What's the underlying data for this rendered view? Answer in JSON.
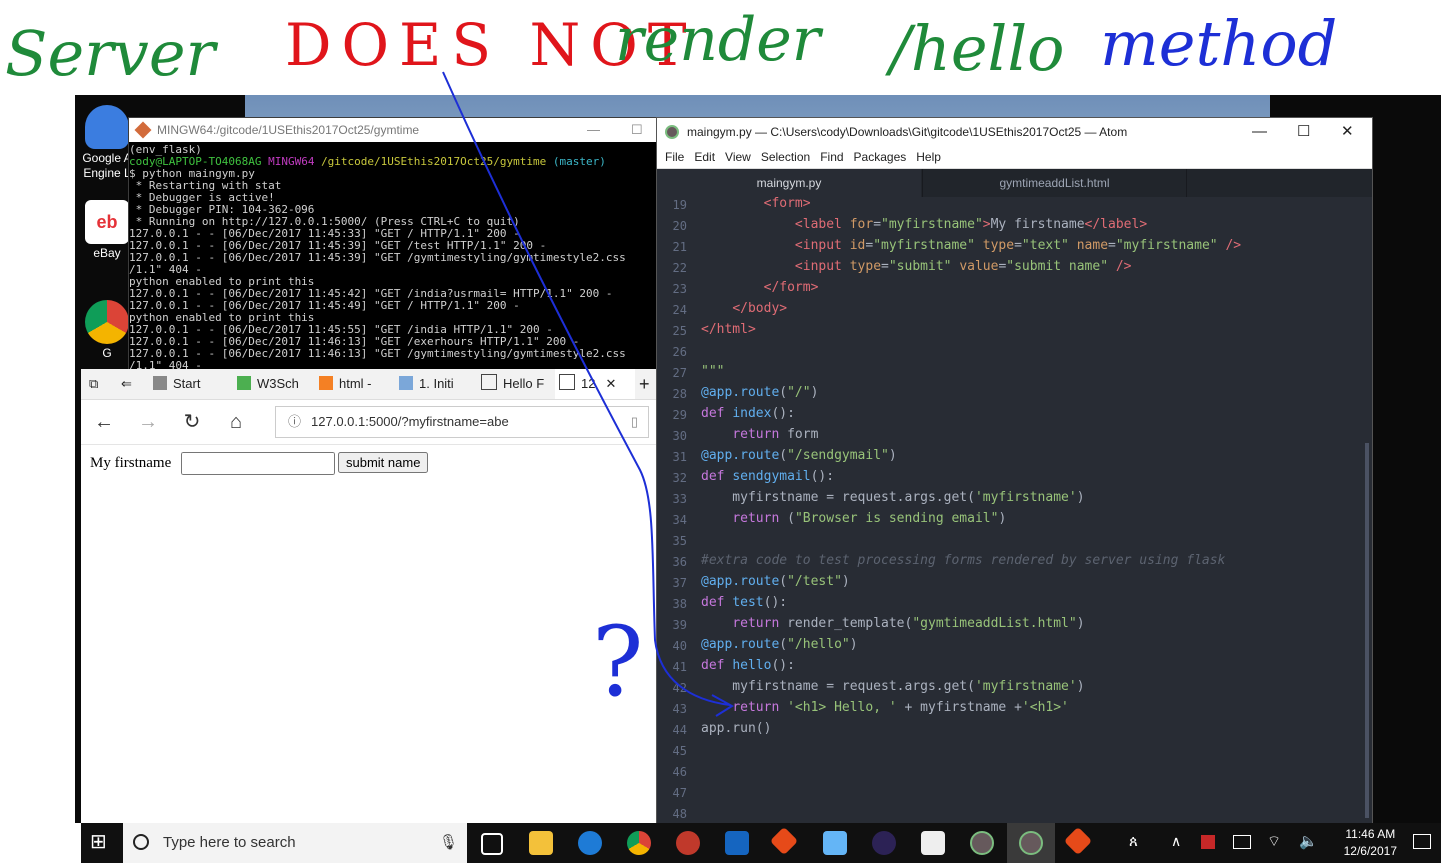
{
  "annotation": {
    "word1": "Server",
    "word2": "DOES NOT",
    "word3": "render",
    "word4": "/hello",
    "word5": "method",
    "question": "?"
  },
  "desktop_icons": [
    {
      "label": "Google A Engine L"
    },
    {
      "label": "eBay"
    },
    {
      "label": "G"
    }
  ],
  "terminal": {
    "title": "MINGW64:/gitcode/1USEthis2017Oct25/gymtime",
    "lines": {
      "l1": "(env_flask)",
      "l2_user": "cody@LAPTOP-TO4068AG",
      "l2_mingw": "MINGW64",
      "l2_path": "/gitcode/1USEthis2017Oct25/gymtime",
      "l2_branch": "(master)",
      "l3": "$ python maingym.py",
      "l4": " * Restarting with stat",
      "l5": " * Debugger is active!",
      "l6": " * Debugger PIN: 104-362-096",
      "l7": " * Running on http://127.0.0.1:5000/ (Press CTRL+C to quit)",
      "l8": "127.0.0.1 - - [06/Dec/2017 11:45:33] \"GET / HTTP/1.1\" 200 -",
      "l9": "127.0.0.1 - - [06/Dec/2017 11:45:39] \"GET /test HTTP/1.1\" 200 -",
      "l10": "127.0.0.1 - - [06/Dec/2017 11:45:39] \"GET /gymtimestyling/gymtimestyle2.css",
      "l11": "/1.1\" 404 -",
      "l12": "python enabled to print this",
      "l13": "127.0.0.1 - - [06/Dec/2017 11:45:42] \"GET /india?usrmail= HTTP/1.1\" 200 -",
      "l14": "127.0.0.1 - - [06/Dec/2017 11:45:49] \"GET / HTTP/1.1\" 200 -",
      "l15": "python enabled to print this",
      "l16": "127.0.0.1 - - [06/Dec/2017 11:45:55] \"GET /india HTTP/1.1\" 200 -",
      "l17": "127.0.0.1 - - [06/Dec/2017 11:46:13] \"GET /exerhours HTTP/1.1\" 200 -",
      "l18": "127.0.0.1 - - [06/Dec/2017 11:46:13] \"GET /gymtimestyling/gymtimestyle2.css",
      "l19": "/1.1\" 404 -"
    }
  },
  "browser": {
    "tabs": [
      "Start",
      "W3Sch",
      "html -",
      "1. Initi",
      "Hello F",
      "12"
    ],
    "url": "127.0.0.1:5000/?myfirstname=abe",
    "form_label": "My firstname",
    "submit_label": "submit name"
  },
  "atom": {
    "title": "maingym.py — C:\\Users\\cody\\Downloads\\Git\\gitcode\\1USEthis2017Oct25 — Atom",
    "menu": [
      "File",
      "Edit",
      "View",
      "Selection",
      "Find",
      "Packages",
      "Help"
    ],
    "tabs": [
      "maingym.py",
      "gymtimeaddList.html"
    ],
    "line_numbers": [
      "19",
      "20",
      "21",
      "22",
      "23",
      "24",
      "25",
      "26",
      "27",
      "28",
      "29",
      "30",
      "31",
      "32",
      "33",
      "34",
      "35",
      "36",
      "37",
      "38",
      "39",
      "40",
      "41",
      "42",
      "43",
      "44",
      "45",
      "46",
      "47",
      "48"
    ]
  },
  "taskbar": {
    "search_placeholder": "Type here to search",
    "time": "11:46 AM",
    "date": "12/6/2017"
  },
  "colors": {
    "annotation_green": "#1f8a3a",
    "annotation_red": "#e0151b",
    "annotation_blue": "#1d2fd6"
  }
}
